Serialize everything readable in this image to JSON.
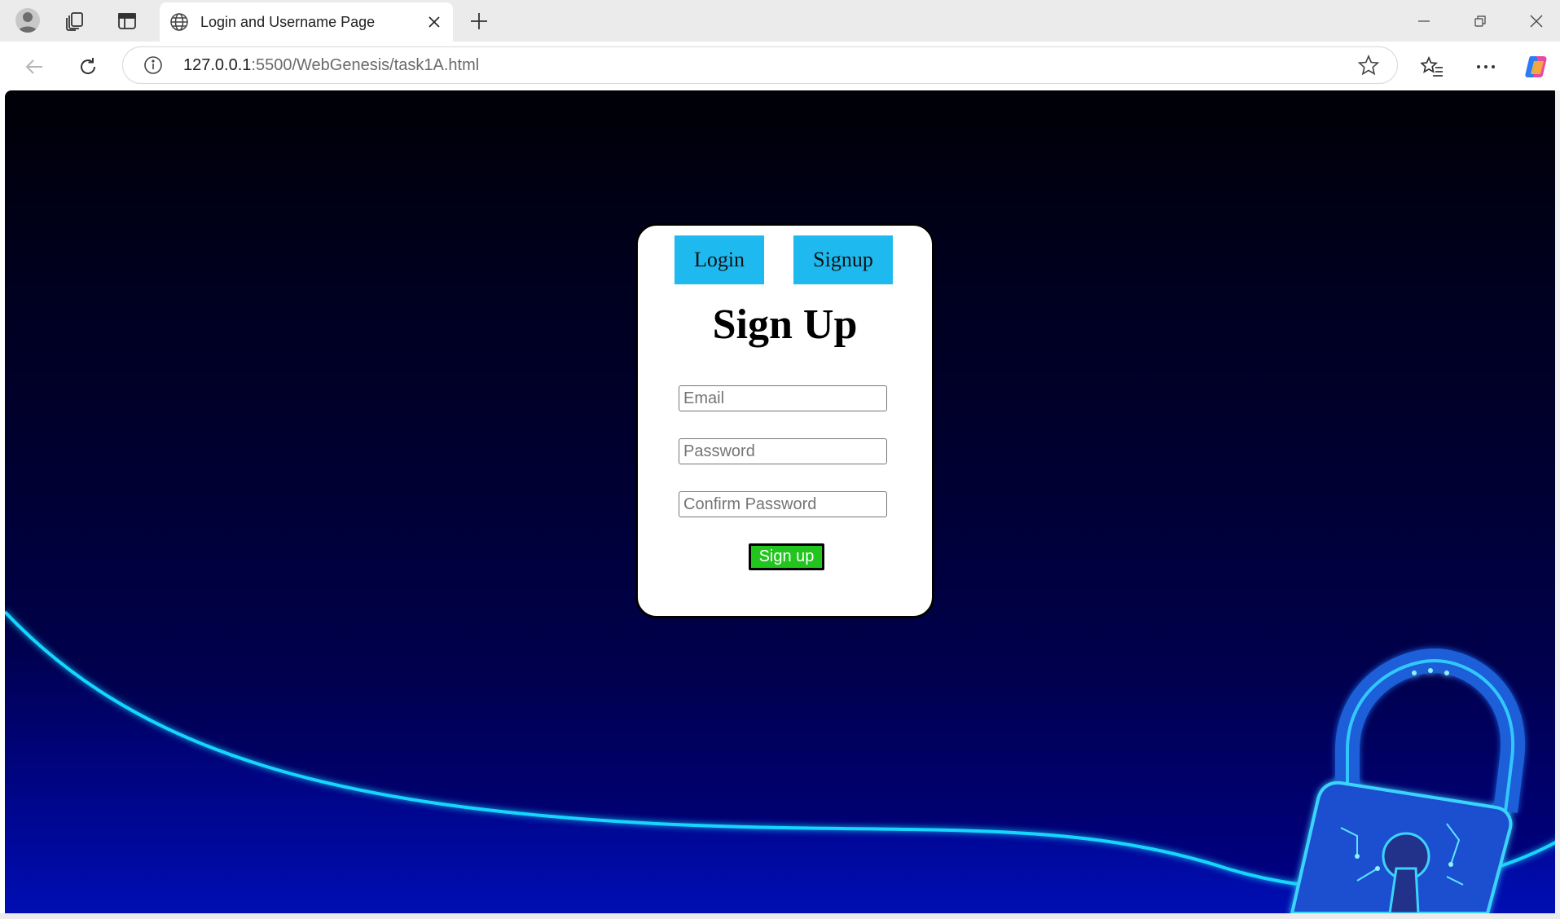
{
  "browser": {
    "tab": {
      "title": "Login and Username Page"
    },
    "address": {
      "host": "127.0.0.1",
      "rest": ":5500/WebGenesis/task1A.html"
    }
  },
  "page": {
    "toggle": {
      "login_label": "Login",
      "signup_label": "Signup"
    },
    "form": {
      "title": "Sign Up",
      "email_placeholder": "Email",
      "password_placeholder": "Password",
      "confirm_placeholder": "Confirm Password",
      "submit_label": "Sign up"
    },
    "colors": {
      "toggle_button": "#1ebaef",
      "submit_button": "#22c41e",
      "neon_line": "#19d6ff",
      "background_top": "#000006",
      "background_bottom": "#00008a"
    }
  },
  "icons": {
    "profile": "profile-icon",
    "workspaces": "workspaces-icon",
    "vertical_tabs": "vertical-tabs-icon",
    "globe": "globe-icon",
    "close": "close-icon",
    "new_tab": "plus-icon",
    "back": "back-arrow-icon",
    "reload": "reload-icon",
    "info": "info-icon",
    "star": "star-icon",
    "favorites": "favorites-icon",
    "more": "more-icon",
    "copilot": "copilot-icon",
    "padlock": "padlock-icon"
  }
}
